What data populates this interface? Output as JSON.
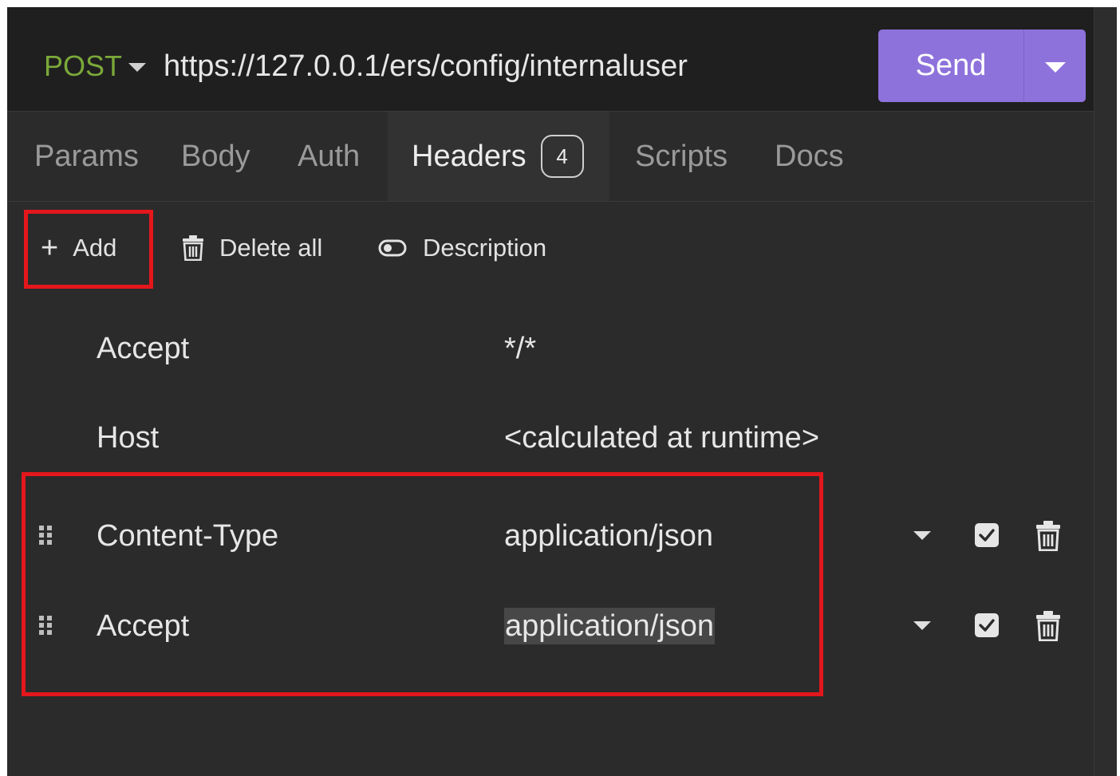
{
  "request": {
    "method": "POST",
    "url": "https://127.0.0.1/ers/config/internaluser",
    "send_label": "Send"
  },
  "tabs": [
    {
      "label": "Params"
    },
    {
      "label": "Body"
    },
    {
      "label": "Auth"
    },
    {
      "label": "Headers",
      "badge": "4"
    },
    {
      "label": "Scripts"
    },
    {
      "label": "Docs"
    }
  ],
  "active_tab": "Headers",
  "toolbar": {
    "add_label": "Add",
    "delete_all_label": "Delete all",
    "description_label": "Description"
  },
  "headers": [
    {
      "name": "Accept",
      "value": "*/*"
    },
    {
      "name": "Host",
      "value": "<calculated at runtime>"
    },
    {
      "name": "Content-Type",
      "value": "application/json",
      "enabled": true
    },
    {
      "name": "Accept",
      "value": "application/json",
      "enabled": true
    }
  ],
  "colors": {
    "method": "#7ba83a",
    "send_button": "#8e72db",
    "highlight": "#e3171c",
    "background": "#2b2b2b"
  },
  "icons": {
    "add": "plus-icon",
    "delete_all": "trash-icon",
    "description": "toggle-icon",
    "row_drag": "drag-handle-icon",
    "row_options": "caret-down-icon",
    "row_enabled": "checkbox-checked-icon",
    "row_delete": "trash-icon"
  }
}
